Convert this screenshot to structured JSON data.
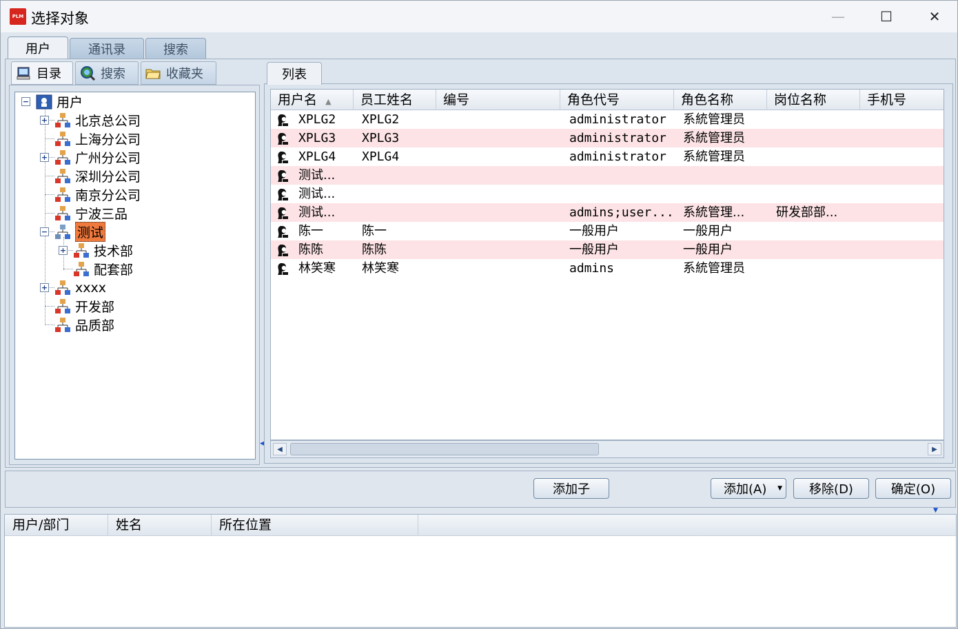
{
  "window": {
    "title": "选择对象",
    "logo_text": "PLM",
    "controls": {
      "minimize": "—",
      "maximize": "☐",
      "close": "✕"
    }
  },
  "main_tabs": [
    "用户",
    "通讯录",
    "搜索"
  ],
  "left_tabs": [
    "目录",
    "搜索",
    "收藏夹"
  ],
  "tree": {
    "root": "用户",
    "nodes": [
      "北京总公司",
      "上海分公司",
      "广州分公司",
      "深圳分公司",
      "南京分公司",
      "宁波三品",
      "测试",
      "技术部",
      "配套部",
      "xxxx",
      "开发部",
      "品质部"
    ]
  },
  "list_tab": "列表",
  "grid": {
    "columns": [
      "用户名",
      "员工姓名",
      "编号",
      "角色代号",
      "角色名称",
      "岗位名称",
      "手机号"
    ],
    "rows": [
      [
        "XPLG2",
        "XPLG2",
        "",
        "administrator",
        "系統管理员",
        ""
      ],
      [
        "XPLG3",
        "XPLG3",
        "",
        "administrator",
        "系統管理员",
        ""
      ],
      [
        "XPLG4",
        "XPLG4",
        "",
        "administrator",
        "系統管理员",
        ""
      ],
      [
        "测试...",
        "",
        "",
        "",
        "",
        ""
      ],
      [
        "测试...",
        "",
        "",
        "",
        "",
        ""
      ],
      [
        "测试...",
        "",
        "",
        "admins;user...",
        "系統管理...",
        "研发部部..."
      ],
      [
        "陈一",
        "陈一",
        "",
        "一般用户",
        "一般用户",
        ""
      ],
      [
        "陈陈",
        "陈陈",
        "",
        "一般用户",
        "一般用户",
        ""
      ],
      [
        "林笑寒",
        "林笑寒",
        "",
        "admins",
        "系統管理员",
        ""
      ]
    ]
  },
  "buttons": {
    "add_child": "添加子",
    "add": "添加(A)",
    "remove": "移除(D)",
    "ok": "确定(O)"
  },
  "selected_grid": {
    "columns": [
      "用户/部门",
      "姓名",
      "所在位置"
    ]
  },
  "colors": {
    "row_alt": "#fde3e6",
    "selected_node": "#f07a3e",
    "logo": "#d7261e"
  }
}
